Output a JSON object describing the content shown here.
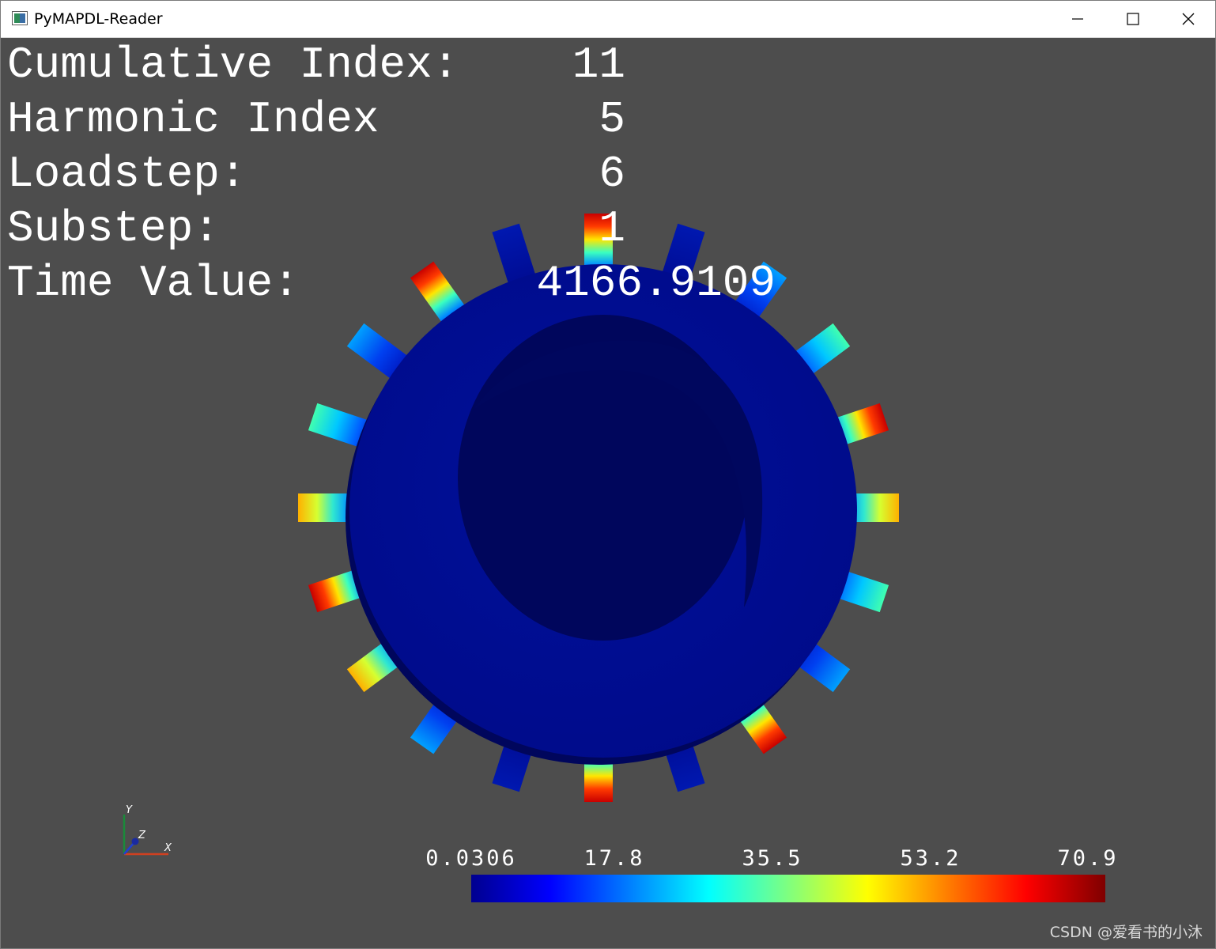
{
  "window": {
    "title": "PyMAPDL-Reader",
    "controls": [
      "minimize",
      "maximize",
      "close"
    ]
  },
  "info_overlay": [
    {
      "label": "Cumulative Index:",
      "value": "11"
    },
    {
      "label": "Harmonic Index",
      "value": "5"
    },
    {
      "label": "Loadstep:",
      "value": "6"
    },
    {
      "label": "Substep:",
      "value": "1"
    },
    {
      "label": "Time Value:",
      "value": "4166.9109"
    }
  ],
  "colorbar": {
    "ticks": [
      "0.0306",
      "17.8",
      "35.5",
      "53.2",
      "70.9"
    ],
    "min": 0.0306,
    "max": 70.9,
    "colormap": "jet"
  },
  "axes": {
    "x": "X",
    "y": "Y",
    "z": "Z"
  },
  "watermark": "CSDN @爱看书的小沐",
  "colors": {
    "background": "#4d4d4d",
    "disk": "#000a8f",
    "text": "#ffffff"
  }
}
